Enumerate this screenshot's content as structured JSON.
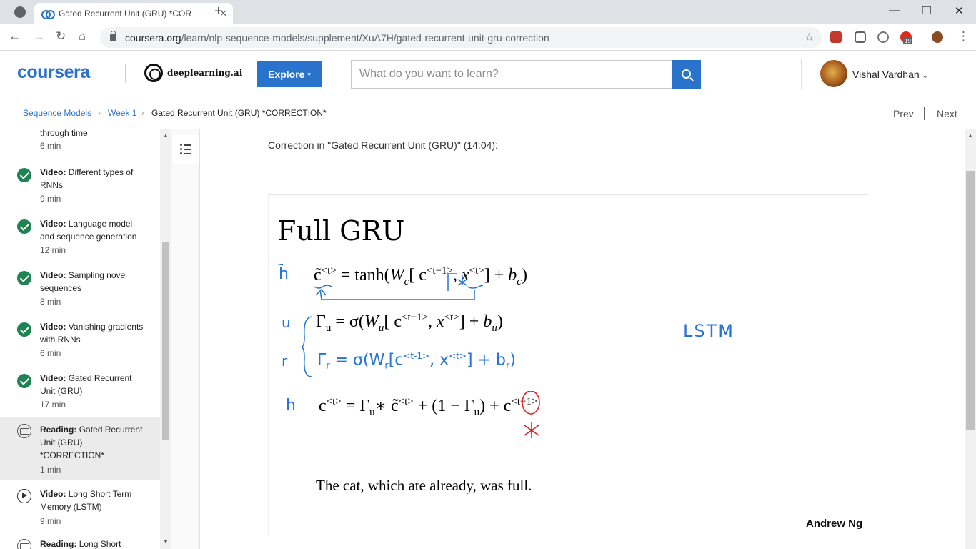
{
  "browser": {
    "tab_title": "Gated Recurrent Unit (GRU) *COR",
    "url_host": "coursera.org",
    "url_path": "/learn/nlp-sequence-models/supplement/XuA7H/gated-recurrent-unit-gru-correction",
    "ext_badge": "19"
  },
  "header": {
    "logo": "coursera",
    "partner": "deeplearning.ai",
    "explore_label": "Explore",
    "search_placeholder": "What do you want to learn?",
    "user_name": "Vishal Vardhan"
  },
  "breadcrumb": {
    "course": "Sequence Models",
    "week": "Week 1",
    "current": "Gated Recurrent Unit (GRU) *CORRECTION*",
    "prev": "Prev",
    "next": "Next"
  },
  "sidebar": {
    "items": [
      {
        "type": "",
        "title": "through time",
        "duration": "6 min"
      },
      {
        "type": "Video:",
        "title": "Different types of RNNs",
        "duration": "9 min"
      },
      {
        "type": "Video:",
        "title": "Language model and sequence generation",
        "duration": "12 min"
      },
      {
        "type": "Video:",
        "title": "Sampling novel sequences",
        "duration": "8 min"
      },
      {
        "type": "Video:",
        "title": "Vanishing gradients with RNNs",
        "duration": "6 min"
      },
      {
        "type": "Video:",
        "title": "Gated Recurrent Unit (GRU)",
        "duration": "17 min"
      },
      {
        "type": "Reading:",
        "title": "Gated Recurrent Unit (GRU) *CORRECTION*",
        "duration": "1 min"
      },
      {
        "type": "Video:",
        "title": "Long Short Term Memory (LSTM)",
        "duration": "9 min"
      },
      {
        "type": "Reading:",
        "title": "Long Short",
        "duration": ""
      }
    ]
  },
  "content": {
    "correction_text": "Correction in \"Gated Recurrent Unit (GRU)\" (14:04):",
    "slide_title": "Full GRU",
    "sentence": "The cat, which ate already, was full.",
    "author": "Andrew Ng",
    "handwritten": {
      "h_tilde": "h̃",
      "u": "u",
      "r": "r",
      "h": "h",
      "lstm": "LSTM"
    }
  }
}
